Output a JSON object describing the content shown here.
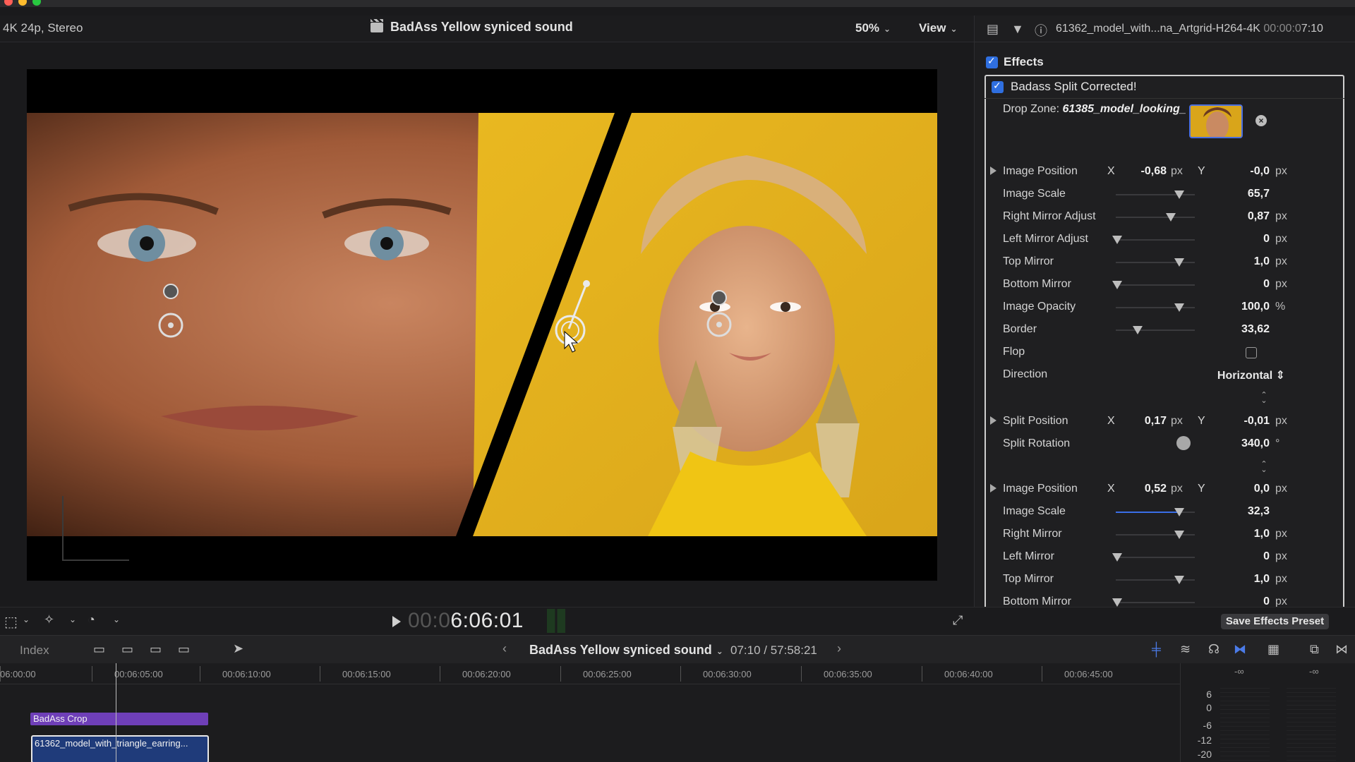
{
  "viewer": {
    "format": "4K 24p, Stereo",
    "project_title": "BadAss Yellow syniced sound",
    "zoom": "50%",
    "view_label": "View"
  },
  "inspector": {
    "clip_name": "61362_model_with...na_Artgrid-H264-4K",
    "clip_duration_dim": "00:00:0",
    "clip_duration": "7:10",
    "effects_label": "Effects",
    "effect_name": "Badass Split Corrected!",
    "drop_zone_label": "Drop Zone:",
    "drop_zone_file": "61385_model_looking_",
    "close_glyph": "×",
    "params": [
      {
        "label": "Image Position",
        "kind": "xy",
        "x": "-0,68",
        "y": "-0,0",
        "unit": "px",
        "x_label": "X",
        "y_label": "Y"
      },
      {
        "label": "Image Scale",
        "kind": "slider",
        "value": "65,7",
        "unit": "",
        "level": 0.8
      },
      {
        "label": "Right Mirror Adjust",
        "kind": "slider",
        "value": "0,87",
        "unit": "px",
        "level": 0.7
      },
      {
        "label": "Left Mirror Adjust",
        "kind": "slider",
        "value": "0",
        "unit": "px",
        "level": 0.02
      },
      {
        "label": "Top Mirror",
        "kind": "slider",
        "value": "1,0",
        "unit": "px",
        "level": 0.8
      },
      {
        "label": "Bottom Mirror",
        "kind": "slider",
        "value": "0",
        "unit": "px",
        "level": 0.02
      },
      {
        "label": "Image Opacity",
        "kind": "slider",
        "value": "100,0",
        "unit": "%",
        "level": 0.8
      },
      {
        "label": "Border",
        "kind": "slider",
        "value": "33,62",
        "unit": "",
        "level": 0.28
      },
      {
        "label": "Flop",
        "kind": "checkbox"
      },
      {
        "label": "Direction",
        "kind": "select",
        "value": "Horizontal"
      },
      {
        "label": "Split Position",
        "kind": "xy",
        "x": "0,17",
        "y": "-0,01",
        "unit": "px",
        "x_label": "X",
        "y_label": "Y"
      },
      {
        "label": "Split Rotation",
        "kind": "dial",
        "value": "340,0",
        "unit": "°"
      },
      {
        "label": "Image Position",
        "kind": "xy",
        "x": "0,52",
        "y": "0,0",
        "unit": "px",
        "x_label": "X",
        "y_label": "Y"
      },
      {
        "label": "Image Scale",
        "kind": "slider",
        "value": "32,3",
        "unit": "",
        "level": 0.8,
        "filled": true
      },
      {
        "label": "Right Mirror",
        "kind": "slider",
        "value": "1,0",
        "unit": "px",
        "level": 0.8
      },
      {
        "label": "Left Mirror",
        "kind": "slider",
        "value": "0",
        "unit": "px",
        "level": 0.02
      },
      {
        "label": "Top Mirror",
        "kind": "slider",
        "value": "1,0",
        "unit": "px",
        "level": 0.8
      },
      {
        "label": "Bottom Mirror",
        "kind": "slider",
        "value": "0",
        "unit": "px",
        "level": 0.02
      }
    ],
    "save_preset_label": "Save Effects Preset"
  },
  "transport": {
    "timecode_dim": "00:0",
    "timecode": "6:06:01"
  },
  "timeline": {
    "index_label": "Index",
    "project_title": "BadAss Yellow syniced sound",
    "position": "07:10 / 57:58:21",
    "ruler": [
      "06:00:00",
      "00:06:05:00",
      "00:06:10:00",
      "00:06:15:00",
      "00:06:20:00",
      "00:06:25:00",
      "00:06:30:00",
      "00:06:35:00",
      "00:06:40:00",
      "00:06:45:00"
    ],
    "title_clip": "BadAss Crop",
    "video_clip": "61362_model_with_triangle_earring..."
  },
  "meters": {
    "peak_left": "-∞",
    "peak_right": "-∞",
    "scale": [
      "6",
      "0",
      "-6",
      "-12",
      "-20"
    ]
  },
  "colors": {
    "accent": "#2f6fe0",
    "title_clip": "#6f3fb8",
    "video_clip": "#1f3b7a",
    "yellow_bg": "#e6b422"
  }
}
